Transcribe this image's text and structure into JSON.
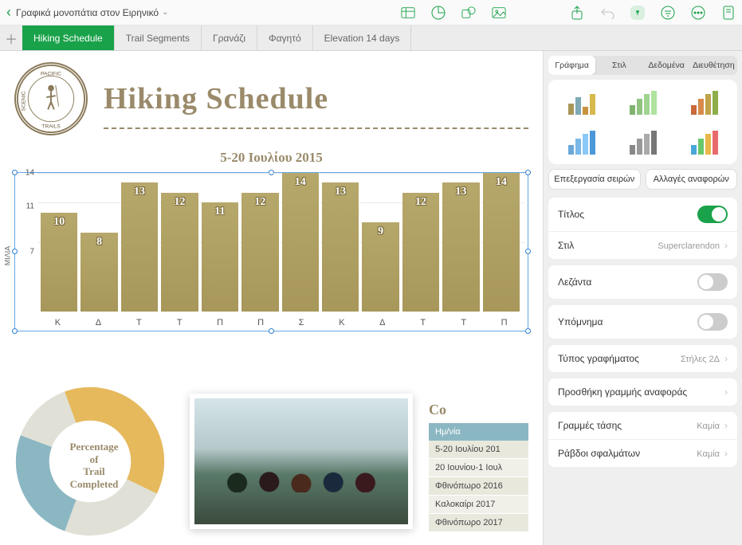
{
  "doc_title": "Γραφικά μονοπάτια στον Ειρηνικό",
  "tabs": [
    "Hiking Schedule",
    "Trail Segments",
    "Γρανάζι",
    "Φαγητό",
    "Elevation 14 days"
  ],
  "page": {
    "logo_text": "SCENIC • PACIFIC • TRAILS",
    "title": "Hiking Schedule"
  },
  "donut": {
    "text": "Percentage\nof\nTrail\nCompleted"
  },
  "side_table": {
    "title": "Co",
    "header": "Ημ/νία",
    "rows": [
      "5-20 Ιουλίου 201",
      "20 Ιουνίου-1 Ιουλ",
      "Φθινόπωρο 2016",
      "Καλοκαίρι 2017",
      "Φθινόπωρο 2017"
    ]
  },
  "panel": {
    "seg": [
      "Γράφημα",
      "Στιλ",
      "Δεδομένα",
      "Διευθέτηση"
    ],
    "edit_series": "Επεξεργασία σειρών",
    "change_refs": "Αλλαγές αναφορών",
    "title_lbl": "Τίτλος",
    "style_lbl": "Στιλ",
    "style_val": "Superclarendon",
    "caption_lbl": "Λεζάντα",
    "legend_lbl": "Υπόμνημα",
    "chart_type_lbl": "Τύπος γραφήματος",
    "chart_type_val": "Στήλες 2Δ",
    "add_ref_lbl": "Προσθήκη γραμμής αναφοράς",
    "trend_lbl": "Γραμμές τάσης",
    "trend_val": "Καμία",
    "err_lbl": "Ράβδοι σφαλμάτων",
    "err_val": "Καμία"
  },
  "chart_data": {
    "type": "bar",
    "title": "5-20 Ιουλίου 2015",
    "ylabel": "ΜΙΛΙΑ",
    "ylim": [
      0,
      14
    ],
    "yticks": [
      7,
      11,
      14
    ],
    "categories": [
      "Κ",
      "Δ",
      "Τ",
      "Τ",
      "Π",
      "Π",
      "Σ",
      "Κ",
      "Δ",
      "Τ",
      "Τ",
      "Π"
    ],
    "values": [
      10,
      8,
      13,
      12,
      11,
      12,
      14,
      13,
      9,
      12,
      13,
      14
    ]
  }
}
